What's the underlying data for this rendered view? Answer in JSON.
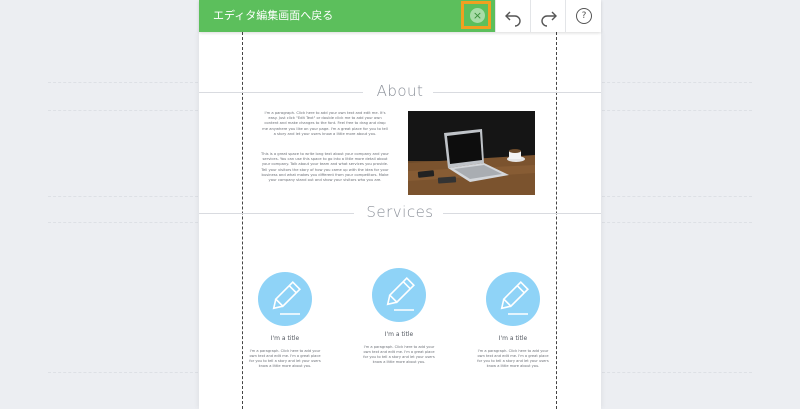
{
  "toolbar": {
    "back_label": "エディタ編集画面へ戻る",
    "close_icon": "×",
    "undo_icon": "↶",
    "redo_icon": "↷",
    "help_icon": "?"
  },
  "about": {
    "title": "About",
    "para1": "I'm a paragraph. Click here to add your own text and edit me. It's easy. Just click \"Edit Text\" or double click me to add your own content and make changes to the font. Feel free to drag and drop me anywhere you like on your page. I'm a great place for you to tell a story and let your users know a little more about you.",
    "para2": "This is a great space to write long text about your company and your services. You can use this space to go into a little more detail about your company. Talk about your team and what services you provide. Tell your visitors the story of how you came up with the idea for your business and what makes you different from your competitors. Make your company stand out and show your visitors who you are."
  },
  "services": {
    "title": "Services",
    "items": [
      {
        "title": "I'm a title",
        "text": "I'm a paragraph. Click here to add your own text and edit me. I'm a great place for you to tell a story and let your users know a little more about you."
      },
      {
        "title": "I'm a title",
        "text": "I'm a paragraph. Click here to add your own text and edit me. I'm a great place for you to tell a story and let your users know a little more about you."
      },
      {
        "title": "I'm a title",
        "text": "I'm a paragraph. Click here to add your own text and edit me. I'm a great place for you to tell a story and let your users know a little more about you."
      }
    ]
  },
  "colors": {
    "accent_green": "#5cbf5c",
    "highlight_orange": "#f0a020",
    "service_blue": "#8fd3f7"
  }
}
